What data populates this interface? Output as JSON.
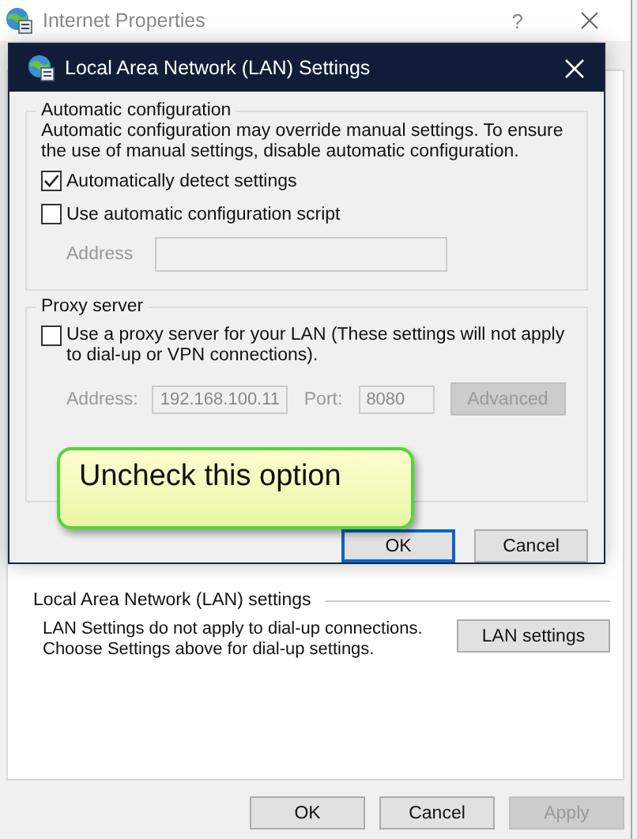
{
  "background_window": {
    "title": "Internet Properties",
    "help": "?",
    "lan_section": {
      "heading": "Local Area Network (LAN) settings",
      "description_lines": [
        "LAN Settings do not apply to dial-up connections.",
        "Choose Settings above for dial-up settings."
      ],
      "button": "LAN settings"
    },
    "buttons": [
      {
        "label": "OK",
        "disabled": false
      },
      {
        "label": "Cancel",
        "disabled": false
      },
      {
        "label": "Apply",
        "disabled": true
      }
    ]
  },
  "dialog": {
    "title": "Local Area Network (LAN) Settings",
    "automatic_configuration": {
      "heading": "Automatic configuration",
      "description": "Automatic configuration may override manual settings.  To ensure the use of manual settings, disable automatic configuration.",
      "checkboxes": [
        {
          "label": "Automatically detect settings",
          "checked": true
        },
        {
          "label": "Use automatic configuration script",
          "checked": false
        }
      ],
      "address": {
        "label": "Address",
        "disabled": true
      }
    },
    "proxy_server": {
      "heading": "Proxy server",
      "checkbox": {
        "label": "Use a proxy server for your LAN (These settings will not apply to dial-up or VPN connections).",
        "checked": false
      },
      "address": {
        "label": "Address:",
        "value": "192.168.100.11",
        "disabled": true
      },
      "port": {
        "label": "Port:",
        "value": "8080",
        "disabled": true
      },
      "advanced_button": {
        "label": "Advanced",
        "disabled": true
      }
    },
    "buttons": [
      {
        "label": "OK",
        "default": true
      },
      {
        "label": "Cancel",
        "default": false
      }
    ]
  },
  "callout": {
    "text": "Uncheck this option"
  }
}
